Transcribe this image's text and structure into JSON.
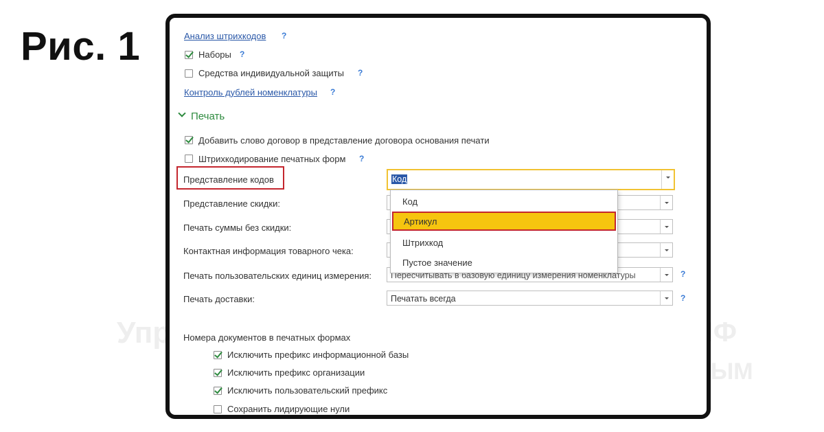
{
  "figure_label": "Рис. 1",
  "links": {
    "barcode_analysis": "Анализ штрихкодов",
    "nomenclature_duplicates": "Контроль дублей номенклатуры"
  },
  "help_mark": "?",
  "checkboxes_top": [
    {
      "label": "Наборы",
      "checked": true
    },
    {
      "label": "Средства индивидуальной защиты",
      "checked": false
    }
  ],
  "print_section": {
    "title": "Печать",
    "checkboxes": [
      {
        "label": "Добавить слово договор в представление договора основания печати",
        "checked": true
      },
      {
        "label": "Штрихкодирование печатных форм",
        "checked": false
      }
    ],
    "fields": [
      {
        "label": "Представление кодов",
        "value": "Код"
      },
      {
        "label": "Представление скидки:",
        "value": ""
      },
      {
        "label": "Печать суммы без скидки:",
        "value": ""
      },
      {
        "label": "Контактная информация товарного чека:",
        "value": ""
      },
      {
        "label": "Печать пользовательских единиц измерения:",
        "value": "Пересчитывать в базовую единицу измерения номенклатуры"
      },
      {
        "label": "Печать доставки:",
        "value": "Печатать всегда"
      }
    ],
    "dropdown_options": [
      "Код",
      "Артикул",
      "Штрихкод",
      "Пустое значение"
    ],
    "dropdown_highlighted": "Артикул"
  },
  "doc_numbers": {
    "title": "Номера документов в печатных формах",
    "checkboxes": [
      {
        "label": "Исключить префикс информационной базы",
        "checked": true
      },
      {
        "label": "Исключить префикс организации",
        "checked": true
      },
      {
        "label": "Исключить пользовательский префикс",
        "checked": true
      },
      {
        "label": "Сохранить лидирующие нули",
        "checked": false
      }
    ]
  },
  "watermark": {
    "left": "Упр",
    "right_top": "НФ",
    "right_bottom": "ЫМ"
  },
  "colors": {
    "accent_green": "#2d8a3e",
    "link_blue": "#2a58a8",
    "highlight_yellow": "#f6c50f",
    "annotation_red": "#c4262e",
    "focus_yellow": "#f1c232"
  }
}
